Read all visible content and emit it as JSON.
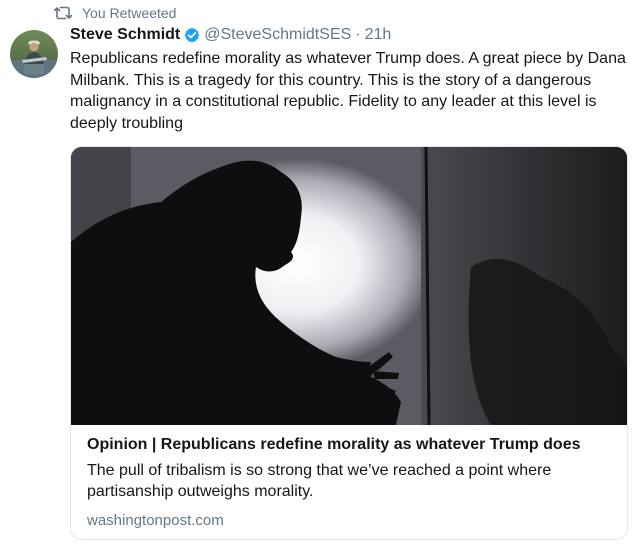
{
  "retweet": {
    "label": "You Retweeted",
    "icon": "retweet-icon"
  },
  "tweet": {
    "author_name": "Steve Schmidt",
    "handle": "@SteveSchmidtSES",
    "separator": "·",
    "time": "21h",
    "verified_icon": "verified-badge-icon",
    "text": "Republicans redefine morality as whatever Trump does. A great piece by Dana Milbank. This is a tragedy for this country. This is the story of a dangerous malignancy in a constitutional republic.  Fidelity to any leader at this level is deeply troubling"
  },
  "card": {
    "title": "Opinion | Republicans redefine morality as whatever Trump does",
    "description": "The pull of tribalism is so strong that we’ve reached a point where partisanship outweighs morality.",
    "domain": "washingtonpost.com"
  },
  "colors": {
    "text": "#14171a",
    "secondary": "#657786",
    "verified": "#1da1f2",
    "border": "#e1e8ed"
  }
}
